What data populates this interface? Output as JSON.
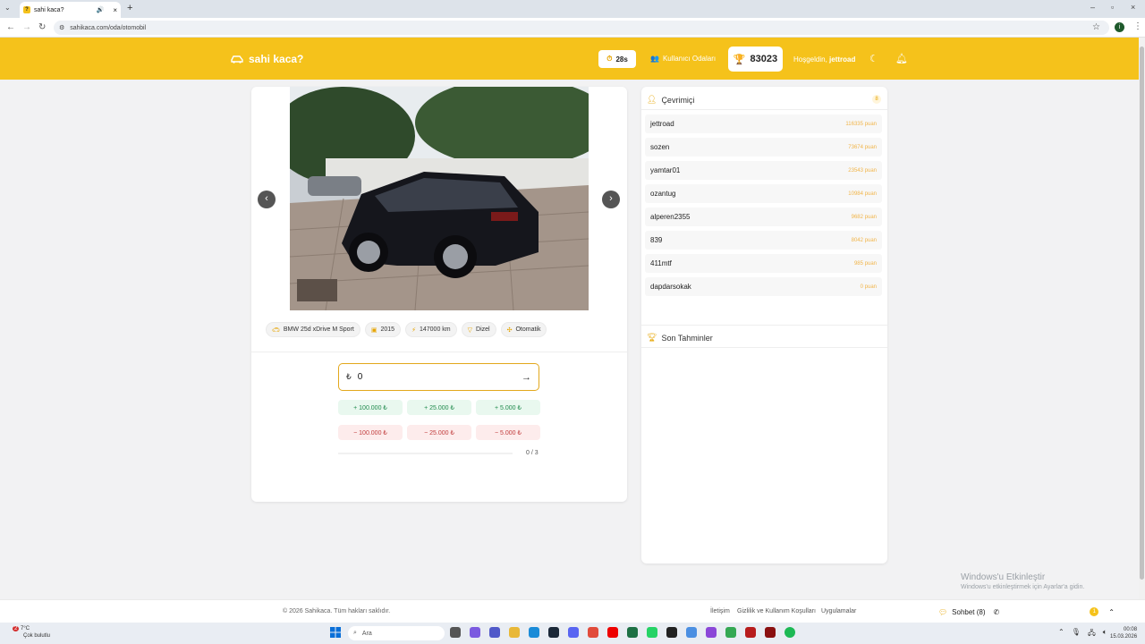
{
  "browser": {
    "tab_title": "sahi kaca?",
    "tab_favicon_letter": "?",
    "url": "sahikaca.com/oda/otomobil"
  },
  "header": {
    "logo": "sahi kaca?",
    "timer": "28s",
    "rooms_label": "Kullanıcı Odaları",
    "score": "83023",
    "welcome": "Hoşgeldin,",
    "username": "jettroad"
  },
  "car": {
    "chips": [
      "BMW 25d xDrive M Sport",
      "2015",
      "147000 km",
      "Dizel",
      "Otomatik"
    ]
  },
  "guess": {
    "currency": "₺",
    "value": "0",
    "plus_buttons": [
      "+ 100.000 ₺",
      "+ 25.000 ₺",
      "+ 5.000 ₺"
    ],
    "minus_buttons": [
      "− 100.000 ₺",
      "− 25.000 ₺",
      "− 5.000 ₺"
    ],
    "progress": 0,
    "count": "0 / 3"
  },
  "online": {
    "title": "Çevrimiçi",
    "count": "8",
    "players": [
      {
        "name": "jettroad",
        "points": "116335 puan"
      },
      {
        "name": "sozen",
        "points": "73674 puan"
      },
      {
        "name": "yamtar01",
        "points": "23543 puan"
      },
      {
        "name": "ozantug",
        "points": "10984 puan"
      },
      {
        "name": "alperen2355",
        "points": "9682 puan"
      },
      {
        "name": "839",
        "points": "8042 puan"
      },
      {
        "name": "411mtf",
        "points": "985 puan"
      },
      {
        "name": "dapdarsokak",
        "points": "0 puan"
      }
    ]
  },
  "recent": {
    "title": "Son Tahminler"
  },
  "footer": {
    "copyright": "© 2026 Sahikaca. Tüm hakları saklıdır.",
    "links": [
      "İletişim",
      "Gizlilik ve Kullanım Koşulları",
      "Uygulamalar"
    ],
    "chat": "Sohbet (8)",
    "chat_unread": "1"
  },
  "watermark": {
    "line1": "Windows'u Etkinleştir",
    "line2": "Windows'u etkinleştirmek için Ayarlar'a gidin."
  },
  "taskbar": {
    "weather_temp": "7°C",
    "weather_desc": "Çok bulutlu",
    "weather_badge": "2",
    "search": "Ara",
    "time": "00:08",
    "date": "15.03.2026"
  },
  "colors": {
    "brand": "#f5c21b",
    "accent_border": "#e3a81c",
    "plus_bg": "#e9f8ef",
    "minus_bg": "#fdecec"
  }
}
